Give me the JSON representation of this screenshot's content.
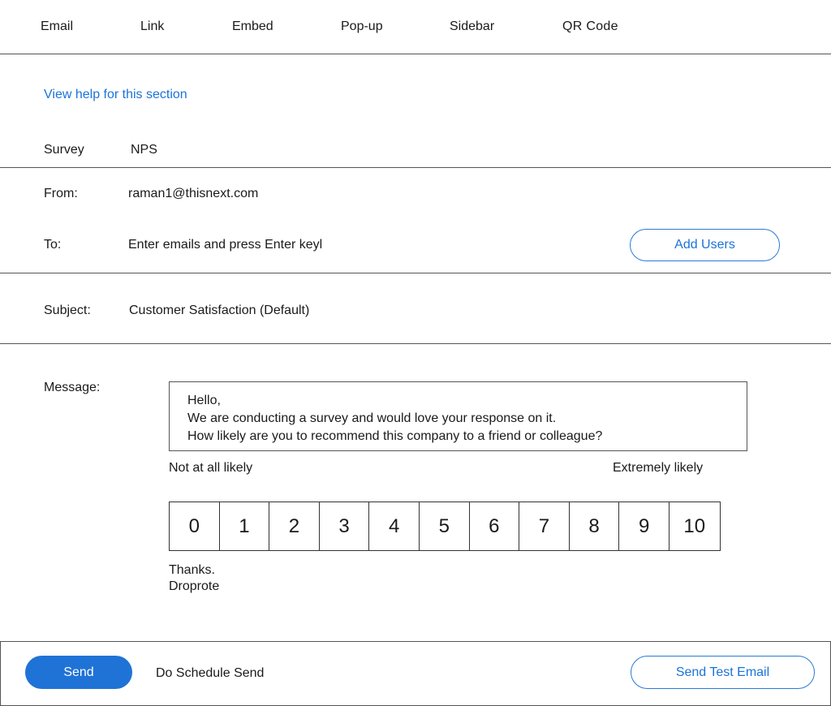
{
  "tabs": [
    {
      "label": "Email"
    },
    {
      "label": "Link"
    },
    {
      "label": "Embed"
    },
    {
      "label": "Pop-up"
    },
    {
      "label": "Sidebar"
    },
    {
      "label": "QR Code"
    }
  ],
  "help_link": "View help for this section",
  "survey": {
    "label": "Survey",
    "value": "NPS"
  },
  "from": {
    "label": "From:",
    "value": "raman1@thisnext.com"
  },
  "to": {
    "label": "To:",
    "placeholder": "Enter emails and press Enter keyl",
    "add_users_label": "Add Users"
  },
  "subject": {
    "label": "Subject:",
    "value": "Customer Satisfaction (Default)"
  },
  "message": {
    "label": "Message:",
    "lines": [
      "Hello,",
      "We are conducting a survey and would love your response on it.",
      "How likely are you to recommend this company to a friend or colleague?"
    ],
    "scale_low_label": "Not at all likely",
    "scale_high_label": "Extremely likely",
    "scale": [
      "0",
      "1",
      "2",
      "3",
      "4",
      "5",
      "6",
      "7",
      "8",
      "9",
      "10"
    ],
    "signoff": [
      "Thanks.",
      "Droprote"
    ]
  },
  "footer": {
    "send_label": "Send",
    "schedule_label": "Do Schedule Send",
    "test_email_label": "Send Test Email"
  },
  "colors": {
    "accent": "#1f73d6",
    "link": "#1a73d9",
    "divider": "#555555"
  }
}
